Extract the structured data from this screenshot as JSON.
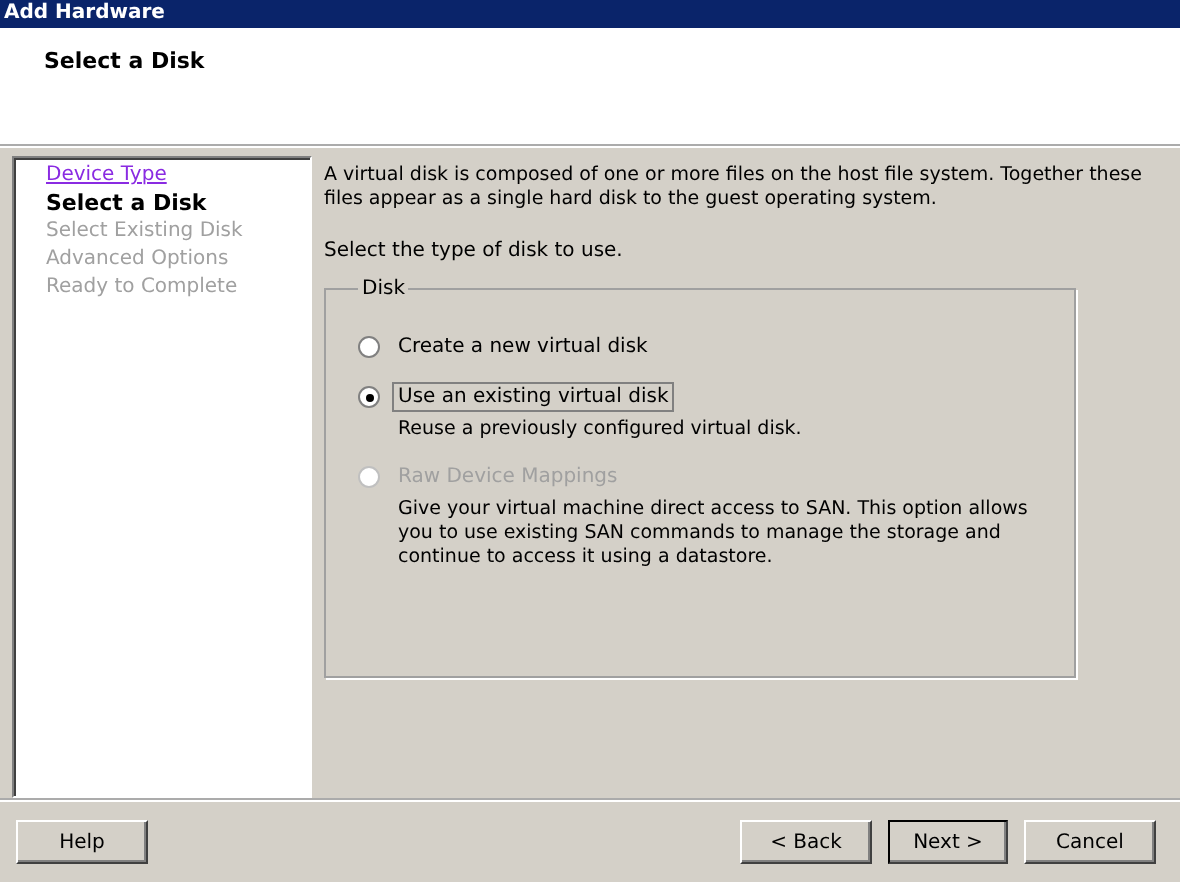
{
  "window": {
    "title": "Add Hardware"
  },
  "header": {
    "title": "Select a Disk"
  },
  "steps": [
    {
      "label": "Device Type",
      "kind": "visited"
    },
    {
      "label": "Select a Disk",
      "kind": "current"
    },
    {
      "label": "Select Existing Disk",
      "kind": "pending"
    },
    {
      "label": "Advanced Options",
      "kind": "pending"
    },
    {
      "label": "Ready to Complete",
      "kind": "pending"
    }
  ],
  "intro": "A virtual disk is composed of one or more files on the host file system. Together these files appear as a single hard disk to the guest operating system.",
  "prompt": "Select the type of disk to use.",
  "group": {
    "legend": "Disk",
    "options": [
      {
        "label": "Create a new virtual disk",
        "selected": false,
        "disabled": false,
        "focused": false
      },
      {
        "label": "Use an existing virtual disk",
        "description": "Reuse a previously configured virtual disk.",
        "selected": true,
        "disabled": false,
        "focused": true
      },
      {
        "label": "Raw Device Mappings",
        "description": "Give your virtual machine direct access to SAN. This option allows you to use existing SAN commands to manage the storage and continue to access it using a datastore.",
        "selected": false,
        "disabled": true,
        "focused": false
      }
    ]
  },
  "buttons": {
    "help": "Help",
    "back": "< Back",
    "next": "Next >",
    "cancel": "Cancel"
  }
}
